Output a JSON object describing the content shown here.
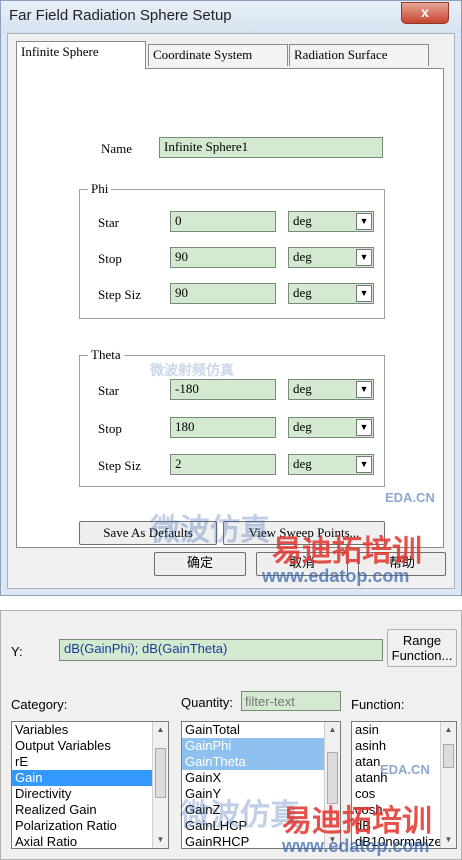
{
  "dialog": {
    "title": "Far Field Radiation Sphere Setup",
    "close_label": "x",
    "tabs": [
      "Infinite Sphere",
      "Coordinate System",
      "Radiation Surface"
    ],
    "name_label": "Name",
    "name_value": "Infinite Sphere1",
    "phi": {
      "legend": "Phi",
      "start_label": "Star",
      "start_value": "0",
      "stop_label": "Stop",
      "stop_value": "90",
      "step_label": "Step Siz",
      "step_value": "90",
      "unit": "deg"
    },
    "theta": {
      "legend": "Theta",
      "start_label": "Star",
      "start_value": "-180",
      "stop_label": "Stop",
      "stop_value": "180",
      "step_label": "Step Siz",
      "step_value": "2",
      "unit": "deg"
    },
    "save_defaults_label": "Save As Defaults",
    "view_sweep_label": "View Sweep Points...",
    "ok_label": "确定",
    "cancel_label": "取消",
    "help_label": "帮助"
  },
  "report": {
    "y_label": "Y:",
    "y_value": "dB(GainPhi); dB(GainTheta)",
    "range_function_label": "Range\nFunction...",
    "category_label": "Category:",
    "quantity_label": "Quantity:",
    "quantity_filter_placeholder": "filter-text",
    "function_label": "Function:",
    "categories": [
      "Variables",
      "Output Variables",
      "rE",
      "Gain",
      "Directivity",
      "Realized Gain",
      "Polarization Ratio",
      "Axial Ratio"
    ],
    "quantities": [
      "GainTotal",
      "GainPhi",
      "GainTheta",
      "GainX",
      "GainY",
      "GainZ",
      "GainLHCP",
      "GainRHCP"
    ],
    "functions": [
      "asin",
      "asinh",
      "atan",
      "atanh",
      "cos",
      "cosh",
      "dB",
      "dB10normalize"
    ]
  },
  "watermark": {
    "brand_cn": "易迪拓培训",
    "url": "www.edatop.com",
    "site_cn": "微波仿真",
    "eda": "EDA.CN",
    "faint_cn": "微波射频仿真"
  },
  "colors": {
    "field_bg": "#d4ead0",
    "selection": "#3399ff",
    "watermark_red": "#e0322b",
    "watermark_blue": "#2f5fa8"
  }
}
